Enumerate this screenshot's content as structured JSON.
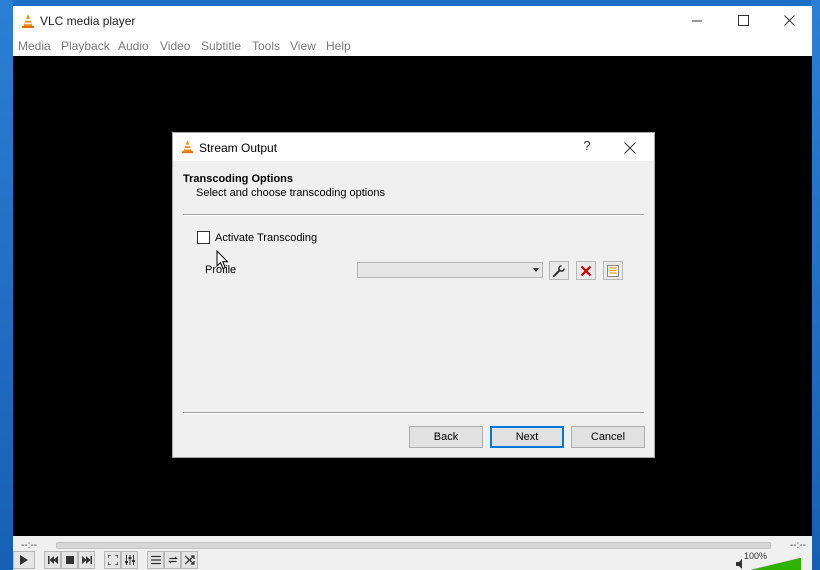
{
  "app": {
    "title": "VLC media player",
    "menu": [
      "Media",
      "Playback",
      "Audio",
      "Video",
      "Subtitle",
      "Tools",
      "View",
      "Help"
    ]
  },
  "player": {
    "time_elapsed": "--:--",
    "time_total": "--:--",
    "volume": "100%",
    "volume_level": 1.0
  },
  "dialog": {
    "title": "Stream Output",
    "help": "?",
    "section_title": "Transcoding Options",
    "section_subtitle": "Select and choose transcoding options",
    "activate_label": "Activate Transcoding",
    "activate_checked": false,
    "profile_label": "Profile",
    "profile_value": "",
    "buttons": {
      "back": "Back",
      "next": "Next",
      "cancel": "Cancel"
    }
  },
  "colors": {
    "vlc_orange": "#f48b00",
    "video_bg": "#000000",
    "accent": "#0078d7",
    "delete_red": "#d40000",
    "desktop": "#1a6fc4"
  },
  "icons": {
    "app": "vlc-cone-icon",
    "profile_edit": "wrench-icon",
    "profile_delete": "red-x-icon",
    "profile_new": "new-profile-icon"
  }
}
